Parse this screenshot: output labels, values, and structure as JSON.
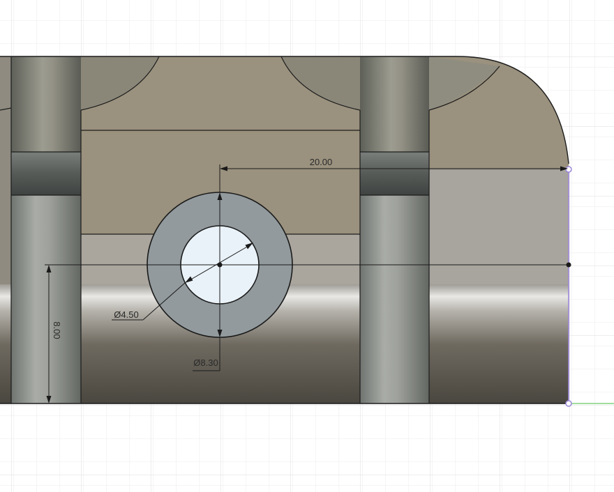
{
  "dimensions": {
    "horizontal": "20.00",
    "vertical": "8.00",
    "inner_diameter": "Ø4.50",
    "outer_diameter": "Ø8.30"
  },
  "colors": {
    "grid": "#e4e4e4",
    "body_tan": "#9a917e",
    "face_light": "#a8a59e",
    "ring": "#929a9d",
    "hole": "#e9f2f8",
    "sketch_line": "#9b86d8",
    "axis_green": "#7ed47e",
    "dimension": "#1a1a1a"
  }
}
